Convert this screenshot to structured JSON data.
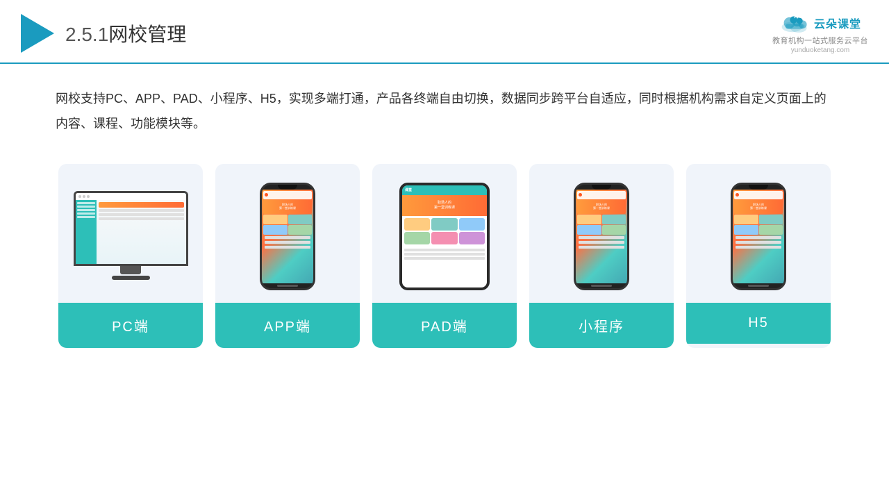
{
  "header": {
    "title": "网校管理",
    "number": "2.5.1",
    "logo_name": "云朵课堂",
    "logo_url": "yunduoketang.com",
    "logo_slogan": "教育机构一站\n式服务云平台"
  },
  "description": "网校支持PC、APP、PAD、小程序、H5，实现多端打通，产品各终端自由切换，数据同步跨平台自适应，同时根据机构需求自定义页面上的内容、课程、功能模块等。",
  "cards": [
    {
      "id": "pc",
      "label": "PC端"
    },
    {
      "id": "app",
      "label": "APP端"
    },
    {
      "id": "pad",
      "label": "PAD端"
    },
    {
      "id": "miniapp",
      "label": "小程序"
    },
    {
      "id": "h5",
      "label": "H5"
    }
  ],
  "accent_color": "#2dbfb8",
  "header_line_color": "#1a9bbf"
}
